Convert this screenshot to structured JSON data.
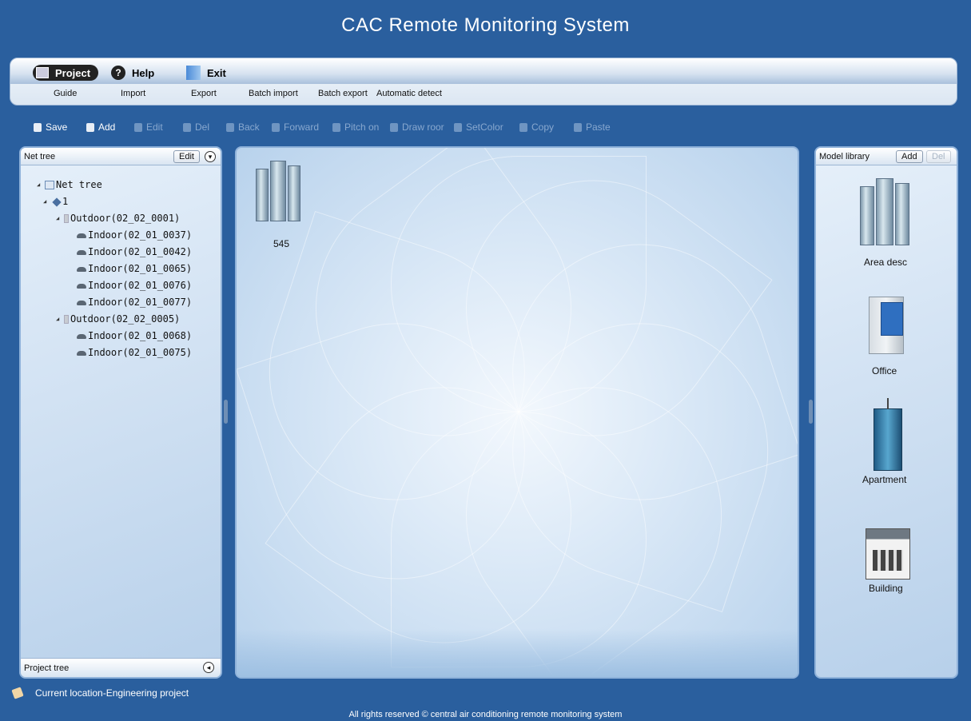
{
  "app_title": "CAC Remote Monitoring System",
  "menu": {
    "project": "Project",
    "help": "Help",
    "exit": "Exit",
    "help_glyph": "?"
  },
  "submenu": [
    "Guide",
    "Import",
    "Export",
    "Batch import",
    "Batch export",
    "Automatic detect"
  ],
  "toolbar": {
    "save": "Save",
    "add": "Add",
    "edit": "Edit",
    "del": "Del",
    "back": "Back",
    "forward": "Forward",
    "pitch_on": "Pitch on",
    "draw_roof": "Draw roor",
    "set_color": "SetColor",
    "copy": "Copy",
    "paste": "Paste"
  },
  "net_panel": {
    "header": "Net tree",
    "edit_btn": "Edit",
    "footer": "Project tree",
    "tree": {
      "root": "Net tree",
      "node": "1",
      "outdoor1": "Outdoor(02_02_0001)",
      "outdoor1_children": [
        "Indoor(02_01_0037)",
        "Indoor(02_01_0042)",
        "Indoor(02_01_0065)",
        "Indoor(02_01_0076)",
        "Indoor(02_01_0077)"
      ],
      "outdoor2": "Outdoor(02_02_0005)",
      "outdoor2_children": [
        "Indoor(02_01_0068)",
        "Indoor(02_01_0075)"
      ]
    }
  },
  "canvas": {
    "item_label": "545"
  },
  "model_library": {
    "header": "Model library",
    "add_btn": "Add",
    "del_btn": "Del",
    "items": [
      "Area desc",
      "Office",
      "Apartment",
      "Building"
    ]
  },
  "status": {
    "location": "Current location-Engineering project"
  },
  "footer": {
    "copyright": "All rights reserved © central air conditioning remote monitoring system"
  },
  "icons": {
    "project": "project-icon",
    "help": "help-icon",
    "exit": "exit-icon",
    "save": "save-icon",
    "add": "add-icon",
    "edit": "edit-icon",
    "del": "delete-icon",
    "back": "back-icon",
    "forward": "forward-icon",
    "pitch_on": "pointer-icon",
    "draw_roof": "draw-roof-icon",
    "set_color": "set-color-icon",
    "copy": "copy-icon",
    "paste": "paste-icon"
  },
  "colors": {
    "background": "#2a5f9e",
    "toolbar_active": "#ffffff",
    "toolbar_disabled": "#88a8cf",
    "panel_border": "#8fb2da"
  }
}
